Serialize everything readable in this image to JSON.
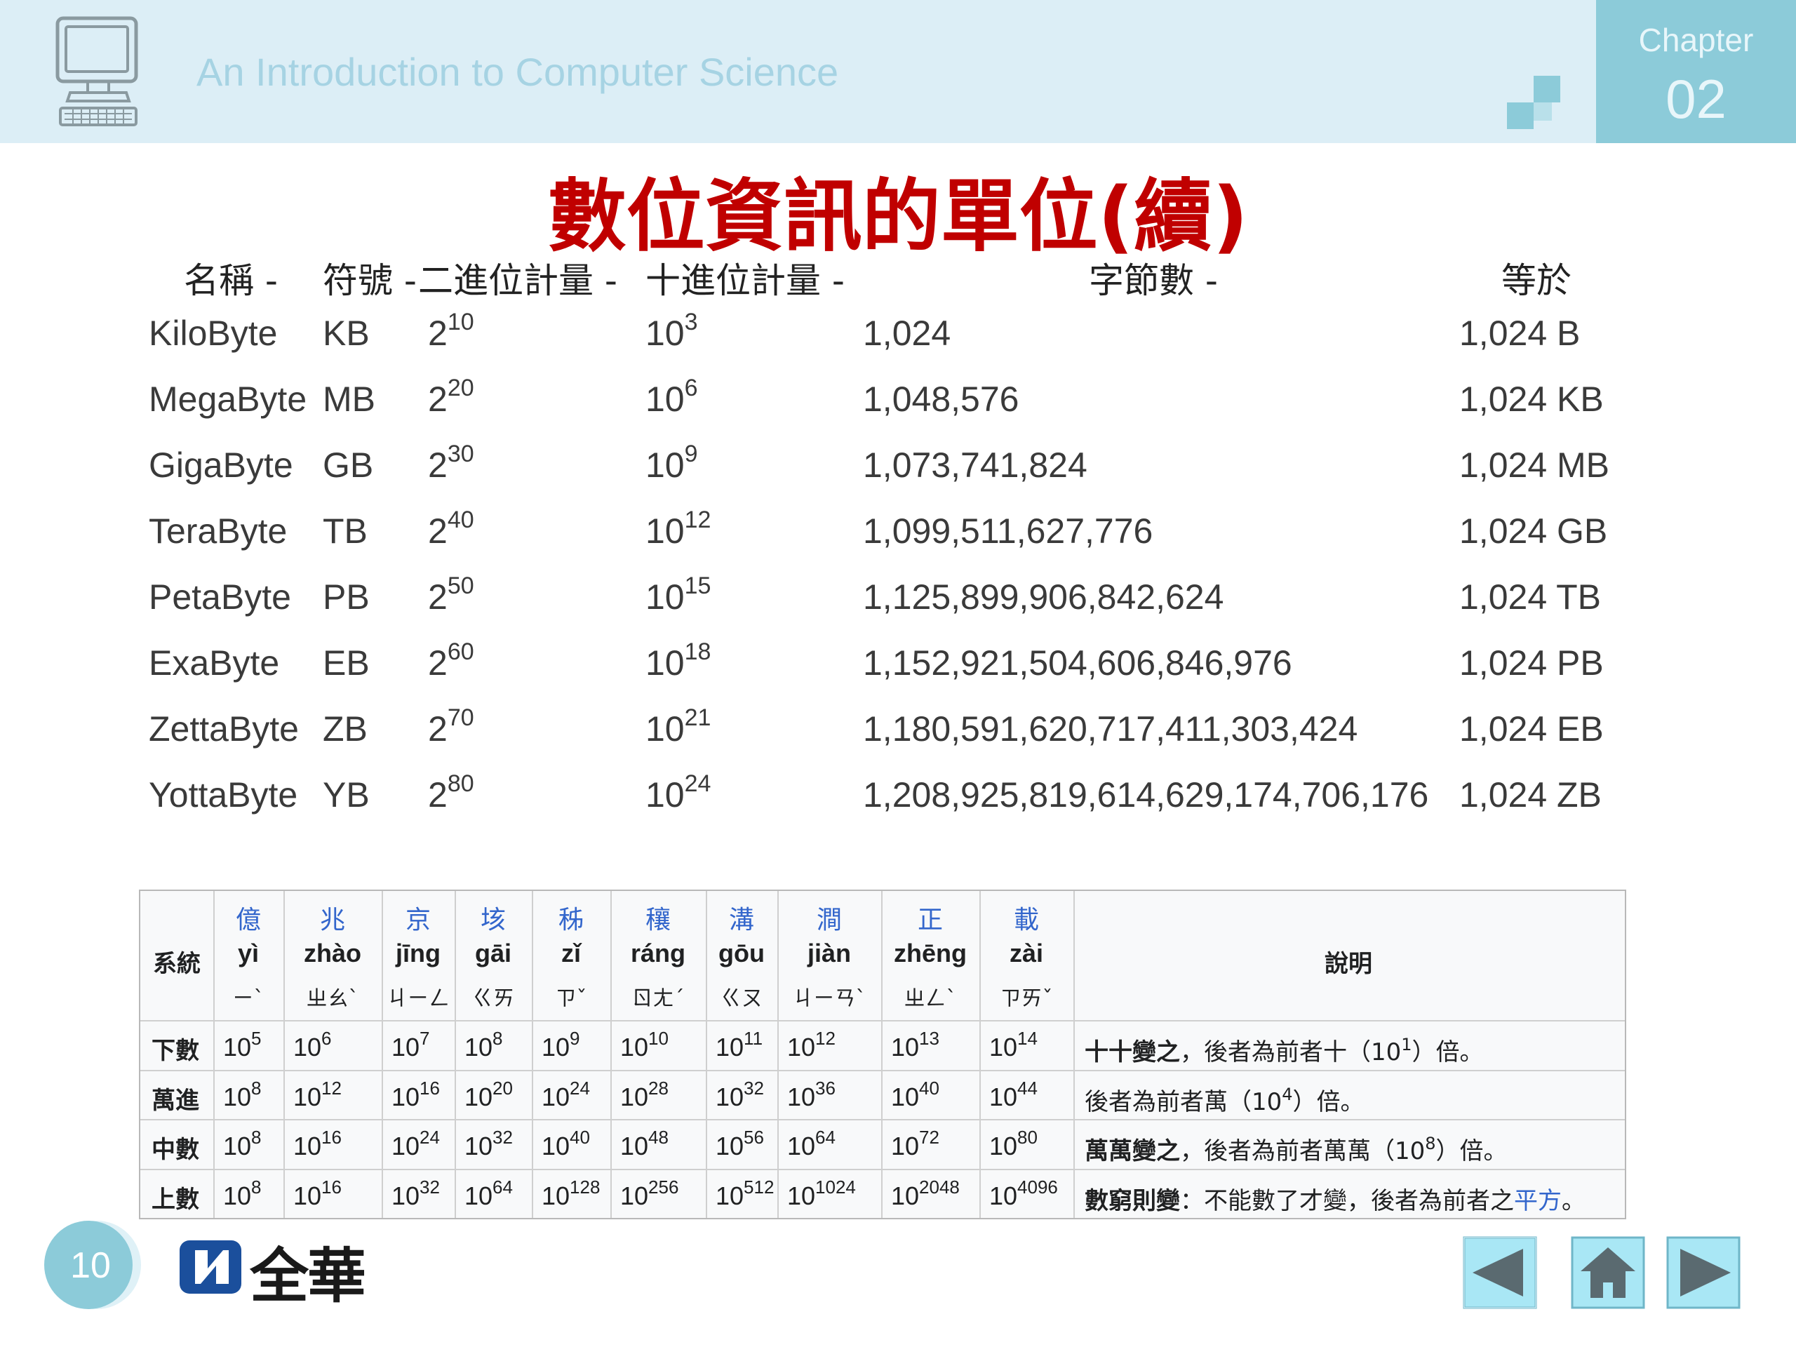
{
  "header": {
    "course_title": "An Introduction to Computer Science",
    "chapter_label": "Chapter",
    "chapter_number": "02"
  },
  "slide": {
    "title": "數位資訊的單位(續)"
  },
  "units_table": {
    "headers": [
      "名稱 -",
      "符號 -",
      "二進位計量 -",
      "十進位計量 -",
      "字節數 -",
      "等於"
    ],
    "rows": [
      {
        "name": "KiloByte",
        "symbol": "KB",
        "bin_base": "2",
        "bin_exp": "10",
        "dec_base": "10",
        "dec_exp": "3",
        "bytes": "1,024",
        "equals": "1,024 B"
      },
      {
        "name": "MegaByte",
        "symbol": "MB",
        "bin_base": "2",
        "bin_exp": "20",
        "dec_base": "10",
        "dec_exp": "6",
        "bytes": "1,048,576",
        "equals": "1,024 KB"
      },
      {
        "name": "GigaByte",
        "symbol": "GB",
        "bin_base": "2",
        "bin_exp": "30",
        "dec_base": "10",
        "dec_exp": "9",
        "bytes": "1,073,741,824",
        "equals": "1,024 MB"
      },
      {
        "name": "TeraByte",
        "symbol": "TB",
        "bin_base": "2",
        "bin_exp": "40",
        "dec_base": "10",
        "dec_exp": "12",
        "bytes": "1,099,511,627,776",
        "equals": "1,024 GB"
      },
      {
        "name": "PetaByte",
        "symbol": "PB",
        "bin_base": "2",
        "bin_exp": "50",
        "dec_base": "10",
        "dec_exp": "15",
        "bytes": "1,125,899,906,842,624",
        "equals": "1,024 TB"
      },
      {
        "name": "ExaByte",
        "symbol": "EB",
        "bin_base": "2",
        "bin_exp": "60",
        "dec_base": "10",
        "dec_exp": "18",
        "bytes": "1,152,921,504,606,846,976",
        "equals": "1,024 PB"
      },
      {
        "name": "ZettaByte",
        "symbol": "ZB",
        "bin_base": "2",
        "bin_exp": "70",
        "dec_base": "10",
        "dec_exp": "21",
        "bytes": "1,180,591,620,717,411,303,424",
        "equals": "1,024 EB"
      },
      {
        "name": "YottaByte",
        "symbol": "YB",
        "bin_base": "2",
        "bin_exp": "80",
        "dec_base": "10",
        "dec_exp": "24",
        "bytes": "1,208,925,819,614,629,174,706,176",
        "equals": "1,024 ZB"
      }
    ]
  },
  "wiki_table": {
    "system_header": "系統",
    "note_header": "說明",
    "units": [
      {
        "hanzi": "億",
        "pinyin": "yì",
        "zhuyin": "ㄧˋ"
      },
      {
        "hanzi": "兆",
        "pinyin": "zhào",
        "zhuyin": "ㄓㄠˋ"
      },
      {
        "hanzi": "京",
        "pinyin": "jīng",
        "zhuyin": "ㄐㄧㄥ"
      },
      {
        "hanzi": "垓",
        "pinyin": "gāi",
        "zhuyin": "ㄍㄞ"
      },
      {
        "hanzi": "秭",
        "pinyin": "zǐ",
        "zhuyin": "ㄗˇ"
      },
      {
        "hanzi": "穰",
        "pinyin": "ráng",
        "zhuyin": "ㄖㄤˊ"
      },
      {
        "hanzi": "溝",
        "pinyin": "gōu",
        "zhuyin": "ㄍㄡ"
      },
      {
        "hanzi": "澗",
        "pinyin": "jiàn",
        "zhuyin": "ㄐㄧㄢˋ"
      },
      {
        "hanzi": "正",
        "pinyin": "zhēng",
        "zhuyin": "ㄓㄥˋ"
      },
      {
        "hanzi": "載",
        "pinyin": "zài",
        "zhuyin": "ㄗㄞˇ"
      }
    ],
    "rows": [
      {
        "system": "下數",
        "exponents": [
          "5",
          "6",
          "7",
          "8",
          "9",
          "10",
          "11",
          "12",
          "13",
          "14"
        ],
        "note_bold": "十十變之",
        "note_pre": "，後者為前者十（10",
        "note_exp": "1",
        "note_post": "）倍。",
        "note_link": ""
      },
      {
        "system": "萬進",
        "exponents": [
          "8",
          "12",
          "16",
          "20",
          "24",
          "28",
          "32",
          "36",
          "40",
          "44"
        ],
        "note_bold": "",
        "note_pre": "後者為前者萬（10",
        "note_exp": "4",
        "note_post": "）倍。",
        "note_link": ""
      },
      {
        "system": "中數",
        "exponents": [
          "8",
          "16",
          "24",
          "32",
          "40",
          "48",
          "56",
          "64",
          "72",
          "80"
        ],
        "note_bold": "萬萬變之",
        "note_pre": "，後者為前者萬萬（10",
        "note_exp": "8",
        "note_post": "）倍。",
        "note_link": ""
      },
      {
        "system": "上數",
        "exponents": [
          "8",
          "16",
          "32",
          "64",
          "128",
          "256",
          "512",
          "1024",
          "2048",
          "4096"
        ],
        "note_bold": "數窮則變",
        "note_pre": "：不能數了才變，後者為前者之",
        "note_exp": "",
        "note_post": "。",
        "note_link": "平方"
      }
    ]
  },
  "footer": {
    "page_number": "10",
    "publisher": "全華",
    "nav": [
      "previous",
      "home",
      "next"
    ]
  },
  "colors": {
    "header_bg": "#dceef6",
    "chapter_bg": "#8ccbd9",
    "title_red": "#c00000",
    "link_blue": "#3366cc",
    "nav_cyan": "#a9e7f5"
  }
}
